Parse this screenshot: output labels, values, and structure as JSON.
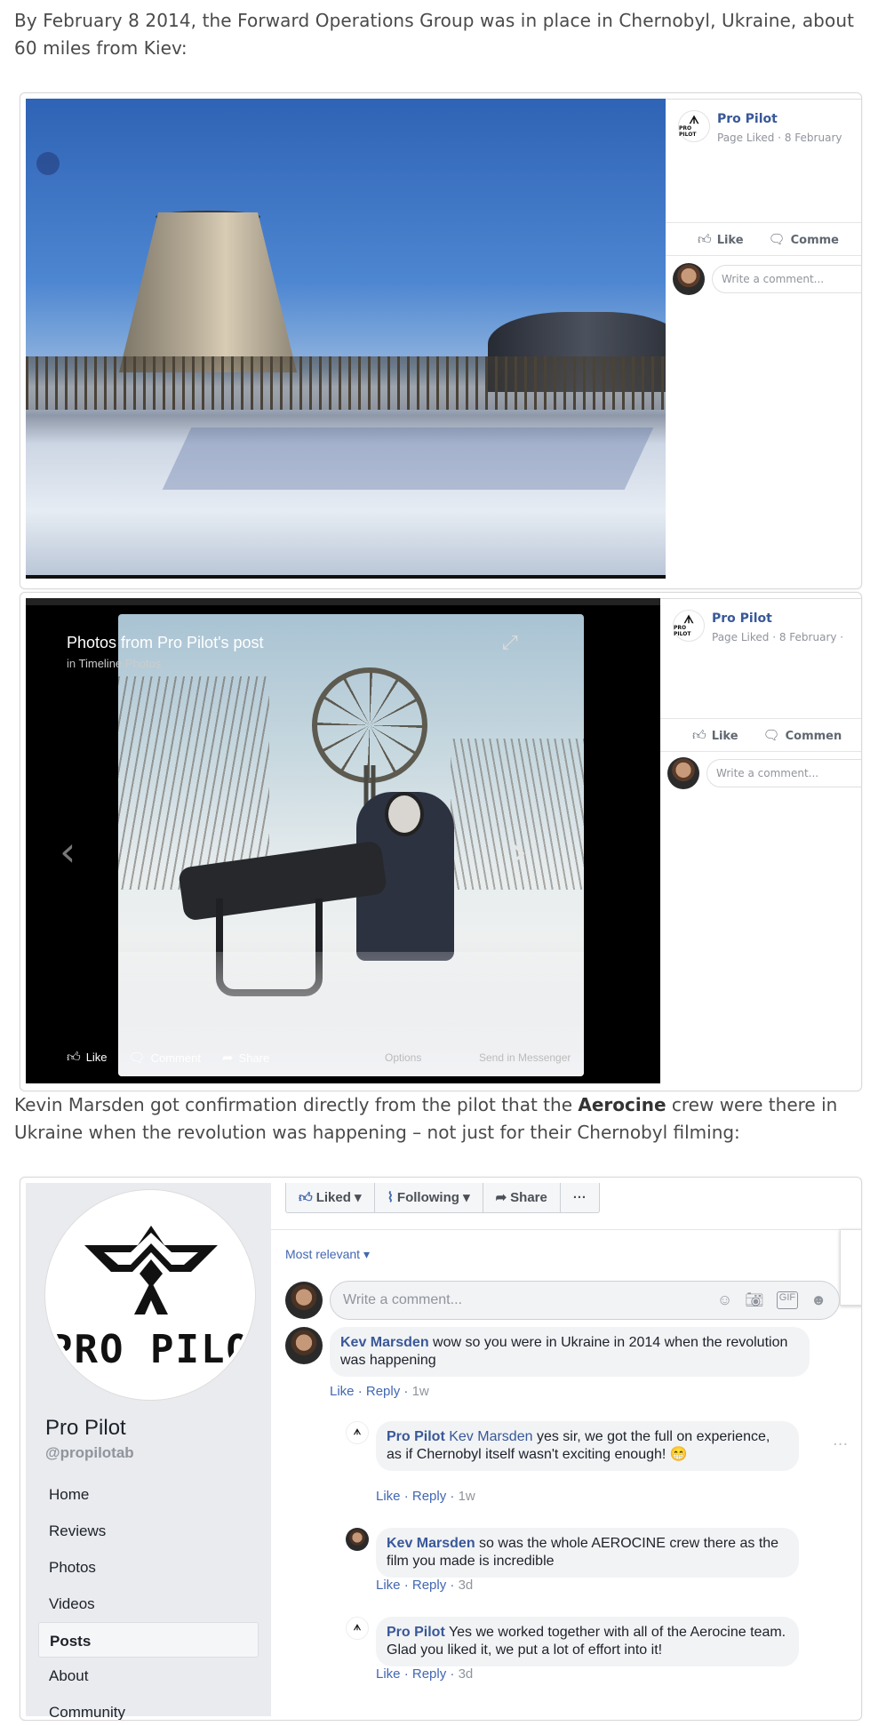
{
  "intro_text": "By February 8 2014, the Forward Operations Group was in place in Chernobyl, Ukraine, about 60 miles from Kiev:",
  "mid_text_before": "Kevin Marsden got confirmation directly from the pilot that the ",
  "mid_text_bold": "Aerocine",
  "mid_text_after": " crew were there in Ukraine when the revolution was happening – not just for their Chernobyl filming:",
  "shot1": {
    "page_name": "Pro Pilot",
    "meta": "Page Liked · 8 February",
    "like_label": "Like",
    "comment_label": "Comme",
    "comment_placeholder": "Write a comment...",
    "avatar_text": "PRO PILOT"
  },
  "shot2": {
    "viewer_title": "Photos from Pro Pilot's post",
    "viewer_in": "in",
    "viewer_album": "Timeline Photos",
    "like_label": "Like",
    "comment_label": "Comment",
    "share_label": "Share",
    "options_label": "Options",
    "messenger_label": "Send in Messenger",
    "page_name": "Pro Pilot",
    "meta": "Page Liked · 8 February · ",
    "side_like": "Like",
    "side_comment": "Commen",
    "comment_placeholder": "Write a comment...",
    "avatar_text": "PRO PILOT"
  },
  "shot3": {
    "logo_text": "PRO PILOT",
    "page_name": "Pro Pilot",
    "handle": "@propilotab",
    "nav": [
      "Home",
      "Reviews",
      "Photos",
      "Videos",
      "Posts",
      "About",
      "Community"
    ],
    "active_nav": "Posts",
    "buttons": {
      "liked": "Liked",
      "following": "Following",
      "share": "Share",
      "more": "···"
    },
    "most_relevant": "Most relevant",
    "write_placeholder": "Write a comment...",
    "comments": [
      {
        "author": "Kev Marsden",
        "text": " wow so you were in Ukraine in 2014 when the revolution was happening",
        "like": "Like",
        "reply": "Reply",
        "time": "1w"
      },
      {
        "author": "Pro Pilot",
        "tag": "Kev Marsden",
        "text": " yes sir, we got the full on experience, as if Chernobyl itself wasn't exciting enough! 😁",
        "like": "Like",
        "reply": "Reply",
        "time": "1w"
      },
      {
        "author": "Kev Marsden",
        "text": " so was the whole AEROCINE crew there as the film you made is incredible",
        "like": "Like",
        "reply": "Reply",
        "time": "3d"
      },
      {
        "author": "Pro Pilot",
        "text": " Yes we worked together with all of the Aerocine team. Glad you liked it, we put a lot of effort into it!",
        "like": "Like",
        "reply": "Reply",
        "time": "3d"
      }
    ]
  },
  "colors": {
    "fb_blue": "#385898",
    "link_blue": "#4267b2",
    "meta_gray": "#90949c",
    "panel_gray": "#e9ebee"
  }
}
